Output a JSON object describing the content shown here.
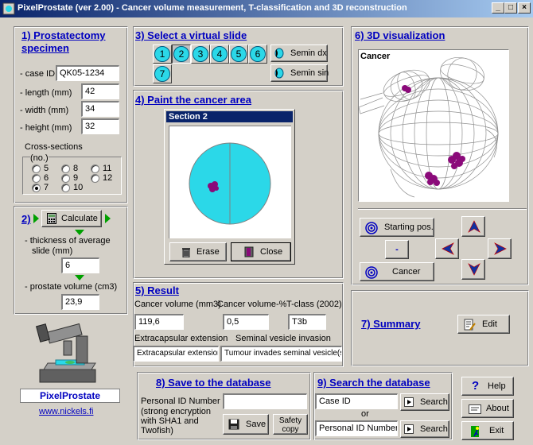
{
  "window": {
    "title": "PixelProstate (ver 2.00) - Cancer volume measurement, T-classification and 3D reconstruction",
    "min_label": "_",
    "max_label": "□",
    "close_label": "×"
  },
  "specimen": {
    "title_line1": "1) Prostatectomy",
    "title_line2": "specimen",
    "case_id_label": "- case ID",
    "case_id_value": "QK05-1234",
    "length_label": "- length  (mm)",
    "length_value": "42",
    "width_label": "- width  (mm)",
    "width_value": "34",
    "height_label": "- height (mm)",
    "height_value": "32",
    "cross_sections_label": "Cross-sections",
    "cross_sections_sub": "(no.)",
    "options": [
      "5",
      "6",
      "7",
      "8",
      "9",
      "10",
      "11",
      "12"
    ],
    "selected": "7"
  },
  "calc": {
    "step_label": "2)",
    "button_label": "Calculate",
    "thickness_label_line1": "- thickness of average",
    "thickness_label_line2": "slide (mm)",
    "thickness_value": "6",
    "volume_label": "- prostate volume (cm3)",
    "volume_value": "23,9"
  },
  "slides": {
    "title": "3) Select a virtual slide",
    "numbers": [
      "1",
      "2",
      "3",
      "4",
      "5",
      "6",
      "7"
    ],
    "selected": "2",
    "semin_dx": "Semin dx",
    "semin_sin": "Semin sin"
  },
  "paint": {
    "title": "4) Paint the cancer area",
    "section_title": "Section 2",
    "erase_label": "Erase",
    "close_label": "Close"
  },
  "result": {
    "title": "5) Result",
    "cancer_volume_label": "Cancer volume (mm3)",
    "cancer_volume_value": "119,6",
    "cancer_pct_label": "Cancer volume-%",
    "cancer_pct_value": "0,5",
    "tclass_label": "T-class (2002)",
    "tclass_value": "T3b",
    "extracap_label": "Extracapsular extension",
    "extracap_value": "Extracapsular extension.",
    "svi_label": "Seminal vesicle invasion",
    "svi_value": "Tumour invades seminal vesicle(s)."
  },
  "viz": {
    "title": "6) 3D visualization",
    "canvas_label": "Cancer",
    "starting_pos_label": "Starting pos.",
    "minus_label": "-",
    "cancer_button_label": "Cancer"
  },
  "summary": {
    "title": "7) Summary",
    "edit_label": "Edit"
  },
  "save": {
    "title": "8) Save to the database",
    "pid_label": "Personal ID Number",
    "note_line1": "(strong encryption",
    "note_line2": "with SHA1 and",
    "note_line3": "Twofish)",
    "save_label": "Save",
    "safety_line1": "Safety",
    "safety_line2": "copy"
  },
  "search": {
    "title": "9) Search the database",
    "case_id_field": "Case ID",
    "or_label": "or",
    "pid_field": "Personal ID Number",
    "search_label": "Search"
  },
  "side": {
    "help_label": "Help",
    "about_label": "About",
    "exit_label": "Exit"
  },
  "brand": {
    "name": "PixelProstate",
    "url": "www.nickels.fi"
  },
  "colors": {
    "accent_blue": "#0000c0",
    "slide_cyan": "#2bd8e8",
    "cancer_purple": "#8b0a7a",
    "arrow_green": "#00a000"
  }
}
